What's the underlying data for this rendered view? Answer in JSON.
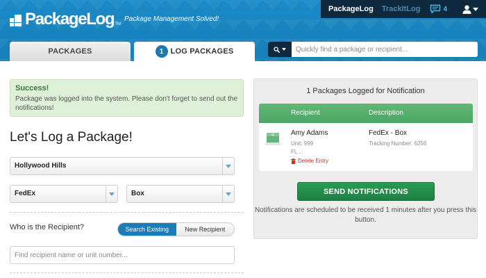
{
  "header": {
    "logo_text": "PackageLog",
    "logo_tm": "TM",
    "tagline": "Package Management Solved!"
  },
  "topnav": {
    "active": "PackageLog",
    "secondary": "TrackItLog",
    "message_count": "4"
  },
  "tabs": [
    {
      "label": "PACKAGES"
    },
    {
      "label": "LOG PACKAGES",
      "badge": "1"
    }
  ],
  "search": {
    "placeholder": "Quickly find a package or recipient..."
  },
  "alert": {
    "title": "Success!",
    "text": "Package was logged into the system. Please don't forget to send out the notifications!"
  },
  "form": {
    "title": "Let's Log a Package!",
    "location": "Hollywood Hills",
    "carrier": "FedEx",
    "package_type": "Box",
    "recipient_question": "Who is the Recipient?",
    "search_existing": "Search Existing",
    "new_recipient": "New Recipient",
    "recipient_placeholder": "Find recipient name or unit number..."
  },
  "panel": {
    "title": "1 Packages Logged for Notification",
    "columns": [
      "Recipient",
      "Description"
    ],
    "rows": [
      {
        "name": "Amy Adams",
        "unit": "Unit: 999",
        "floor": "FL ...",
        "delete_label": "Delete Entry",
        "description": "FedEx - Box",
        "tracking": "Tracking Number: 6256"
      }
    ],
    "send_button": "SEND NOTIFICATIONS",
    "note": "Notifications are scheduled to be received 1 minutes after you press this button."
  },
  "colors": {
    "header_blue": "#1a8ac7",
    "nav_dark": "#0f2a3f",
    "accent_blue": "#1c78b0",
    "success_green": "#3c763d",
    "table_green": "#4aa662",
    "button_green": "#1e7f43",
    "delete_red": "#c9302c"
  },
  "icons": [
    "logo-mark-icon",
    "chat-bubble-icon",
    "user-icon",
    "search-icon",
    "chevron-down-icon",
    "package-box-icon",
    "trash-icon"
  ]
}
